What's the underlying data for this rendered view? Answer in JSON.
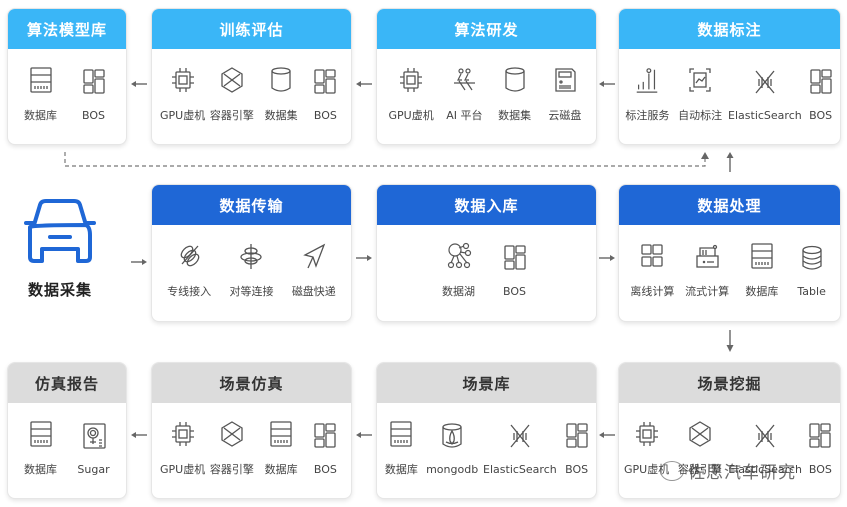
{
  "diagram": {
    "start": {
      "label": "数据采集",
      "icon": "car-icon",
      "accent": "#1f67d6"
    },
    "colors": {
      "sky_header": "#3ab6f7",
      "blue_header": "#1f67d6",
      "gray_header": "#dcdcdc"
    },
    "top_row": [
      {
        "title": "算法模型库",
        "items": [
          {
            "icon": "database-icon",
            "label": "数据库"
          },
          {
            "icon": "bos-icon",
            "label": "BOS"
          }
        ]
      },
      {
        "title": "训练评估",
        "items": [
          {
            "icon": "gpu-chip-icon",
            "label": "GPU虚机"
          },
          {
            "icon": "container-engine-icon",
            "label": "容器引擎"
          },
          {
            "icon": "dataset-cylinder-icon",
            "label": "数据集"
          },
          {
            "icon": "bos-icon",
            "label": "BOS"
          }
        ]
      },
      {
        "title": "算法研发",
        "items": [
          {
            "icon": "gpu-chip-icon",
            "label": "GPU虚机"
          },
          {
            "icon": "ai-platform-icon",
            "label": "AI 平台"
          },
          {
            "icon": "dataset-cylinder-icon",
            "label": "数据集"
          },
          {
            "icon": "cloud-disk-icon",
            "label": "云磁盘"
          }
        ]
      },
      {
        "title": "数据标注",
        "items": [
          {
            "icon": "annotation-service-icon",
            "label": "标注服务"
          },
          {
            "icon": "auto-annotation-icon",
            "label": "自动标注"
          },
          {
            "icon": "elasticsearch-icon",
            "label": "ElasticSearch"
          },
          {
            "icon": "bos-icon",
            "label": "BOS"
          }
        ]
      }
    ],
    "middle_row": [
      {
        "title": "数据传输",
        "items": [
          {
            "icon": "dedicated-line-icon",
            "label": "专线接入"
          },
          {
            "icon": "peer-connection-icon",
            "label": "对等连接"
          },
          {
            "icon": "disk-express-icon",
            "label": "磁盘快递"
          }
        ]
      },
      {
        "title": "数据入库",
        "items": [
          {
            "icon": "data-lake-icon",
            "label": "数据湖"
          },
          {
            "icon": "bos-icon",
            "label": "BOS"
          }
        ]
      },
      {
        "title": "数据处理",
        "items": [
          {
            "icon": "offline-compute-icon",
            "label": "离线计算"
          },
          {
            "icon": "stream-compute-icon",
            "label": "流式计算"
          },
          {
            "icon": "database-icon",
            "label": "数据库"
          },
          {
            "icon": "table-icon",
            "label": "Table"
          }
        ]
      }
    ],
    "bottom_row": [
      {
        "title": "仿真报告",
        "items": [
          {
            "icon": "database-icon",
            "label": "数据库"
          },
          {
            "icon": "sugar-icon",
            "label": "Sugar"
          }
        ]
      },
      {
        "title": "场景仿真",
        "items": [
          {
            "icon": "gpu-chip-icon",
            "label": "GPU虚机"
          },
          {
            "icon": "container-engine-icon",
            "label": "容器引擎"
          },
          {
            "icon": "database-icon",
            "label": "数据库"
          },
          {
            "icon": "bos-icon",
            "label": "BOS"
          }
        ]
      },
      {
        "title": "场景库",
        "items": [
          {
            "icon": "database-icon",
            "label": "数据库"
          },
          {
            "icon": "mongodb-icon",
            "label": "mongodb"
          },
          {
            "icon": "elasticsearch-icon",
            "label": "ElasticSearch"
          },
          {
            "icon": "bos-icon",
            "label": "BOS"
          }
        ]
      },
      {
        "title": "场景挖掘",
        "items": [
          {
            "icon": "gpu-chip-icon",
            "label": "GPU虚机"
          },
          {
            "icon": "container-engine-icon",
            "label": "容器引擎"
          },
          {
            "icon": "elasticsearch-icon",
            "label": "ElasticSearch"
          },
          {
            "icon": "bos-icon",
            "label": "BOS"
          }
        ]
      }
    ],
    "watermark": "佐思汽车研究"
  }
}
